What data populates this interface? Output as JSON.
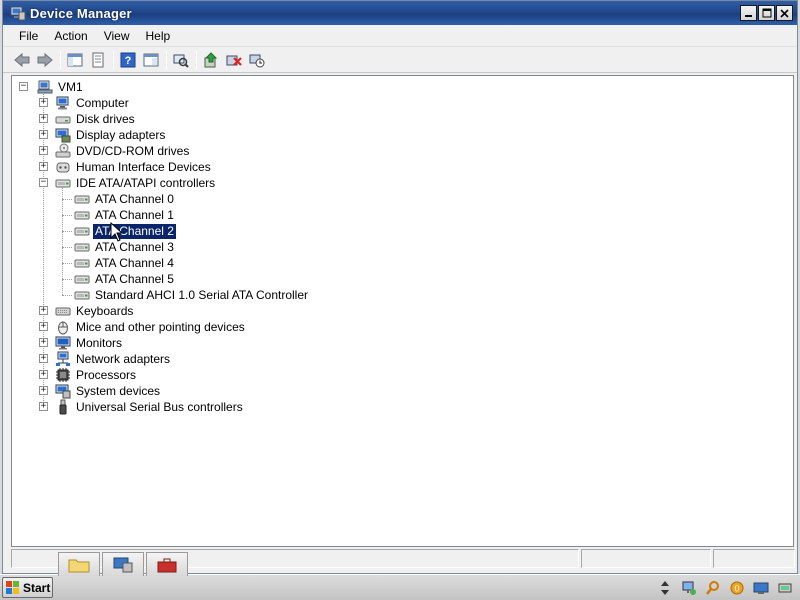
{
  "window": {
    "title": "Device Manager",
    "buttons": [
      "minimize",
      "maximize",
      "close"
    ]
  },
  "menu": {
    "items": [
      "File",
      "Action",
      "View",
      "Help"
    ]
  },
  "toolbar": {
    "buttons": [
      "back-icon",
      "forward-icon",
      "show-hide-console-tree-icon",
      "properties-icon",
      "help-icon",
      "console-icon",
      "scan-hardware-icon",
      "update-driver-icon",
      "uninstall-icon",
      "disable-icon"
    ]
  },
  "tree": {
    "root": "VM1",
    "categories": [
      {
        "label": "Computer",
        "icon": "computer-icon"
      },
      {
        "label": "Disk drives",
        "icon": "disk-drive-icon"
      },
      {
        "label": "Display adapters",
        "icon": "display-adapter-icon"
      },
      {
        "label": "DVD/CD-ROM drives",
        "icon": "dvd-drive-icon"
      },
      {
        "label": "Human Interface Devices",
        "icon": "hid-icon"
      },
      {
        "label": "IDE ATA/ATAPI controllers",
        "icon": "ide-controller-icon",
        "expanded": true
      },
      {
        "label": "Keyboards",
        "icon": "keyboard-icon"
      },
      {
        "label": "Mice and other pointing devices",
        "icon": "mouse-icon"
      },
      {
        "label": "Monitors",
        "icon": "monitor-icon"
      },
      {
        "label": "Network adapters",
        "icon": "network-adapter-icon"
      },
      {
        "label": "Processors",
        "icon": "processor-icon"
      },
      {
        "label": "System devices",
        "icon": "system-devices-icon"
      },
      {
        "label": "Universal Serial Bus controllers",
        "icon": "usb-icon"
      }
    ],
    "ide_children": [
      "ATA Channel 0",
      "ATA Channel 1",
      "ATA Channel 2",
      "ATA Channel 3",
      "ATA Channel 4",
      "ATA Channel 5",
      "Standard AHCI 1.0 Serial ATA Controller"
    ],
    "selected": "ATA Channel 2"
  },
  "taskbar": {
    "start_label": "Start",
    "task_buttons": [
      "explorer-folder-icon",
      "server-manager-icon",
      "toolbox-icon"
    ],
    "tray_icons": [
      "scroll-arrows-icon",
      "network-icon",
      "search-icon",
      "volume-icon",
      "display-icon",
      "power-icon"
    ]
  },
  "colors": {
    "title_bar": "#22478a",
    "selection": "#0a246a",
    "window_bg": "#f0f0f0",
    "tree_bg": "#ffffff"
  }
}
